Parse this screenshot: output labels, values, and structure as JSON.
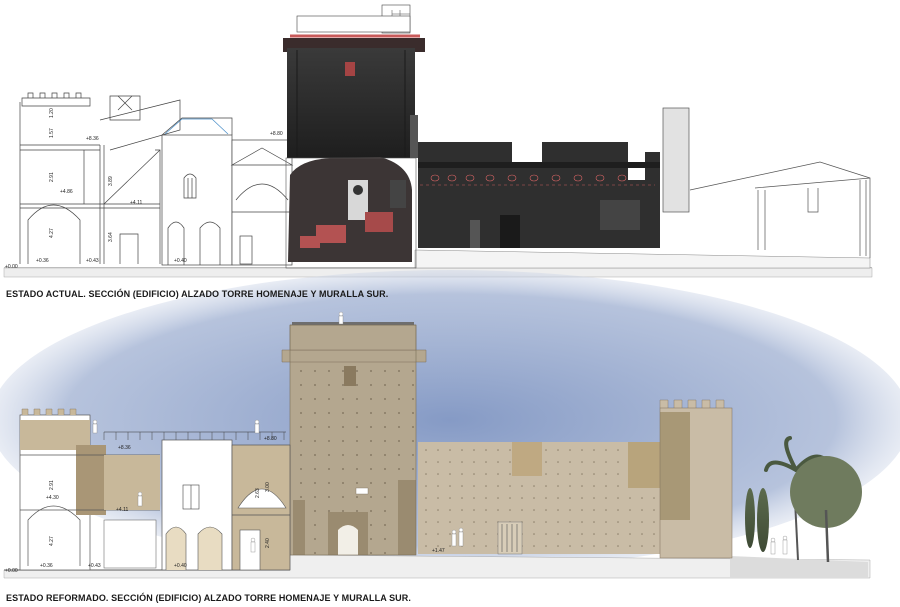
{
  "captions": {
    "top": "ESTADO ACTUAL. SECCIÓN (EDIFICIO) ALZADO TORRE HOMENAJE Y MURALLA SUR.",
    "bottom": "ESTADO REFORMADO. SECCIÓN (EDIFICIO) ALZADO TORRE HOMENAJE Y MURALLA SUR."
  },
  "levels_top": {
    "ground": "+0.00",
    "l036": "+0.36",
    "l043": "+0.43",
    "l040": "+0.40",
    "l411": "+4.11",
    "l486": "+4.86",
    "l836": "+8.36",
    "l880": "+8.80"
  },
  "heights_top": {
    "h427": "4.27",
    "h291": "2.91",
    "h157": "1.57",
    "h120": "1.20",
    "h364": "3.64",
    "h389": "3.89"
  },
  "levels_bottom": {
    "ground": "+0.00",
    "l036": "+0.36",
    "l043": "+0.43",
    "l040": "+0.40",
    "l411": "+4.11",
    "l430": "+4.30",
    "l836": "+8.36",
    "l880": "+8.80",
    "l147": "+1.47"
  },
  "heights_bottom": {
    "h427": "4.27",
    "h291": "2.91",
    "h263": "2.63",
    "h300": "3.00",
    "h240": "2.40"
  },
  "colors": {
    "stone": "#b2a58e",
    "stone_dark": "#8f8067",
    "sky": "#9aaccd",
    "photo_dark": "#2b2b2b",
    "brick": "#c85a5a"
  }
}
